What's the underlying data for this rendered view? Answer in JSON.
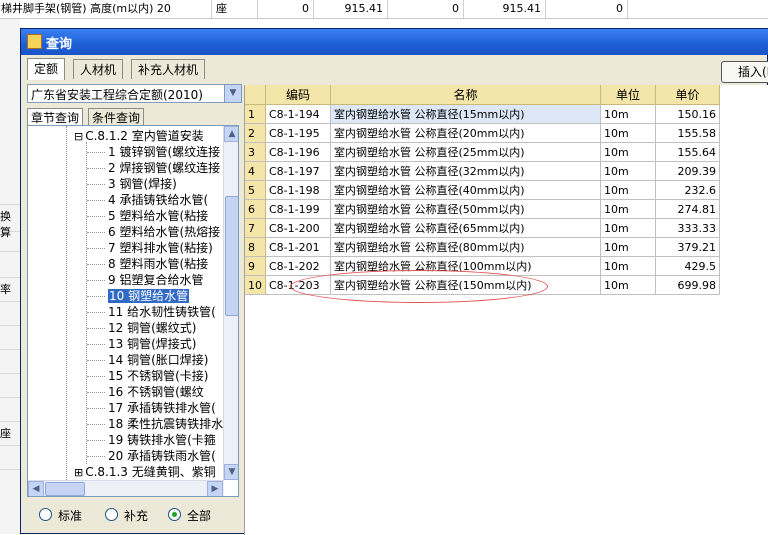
{
  "background": {
    "row_title": "梯井脚手架(钢管) 高度(m以内) 20",
    "row_unit": "座",
    "row_values": [
      "0",
      "915.41",
      "0",
      "915.41",
      "0"
    ],
    "left_labels": [
      "换算",
      "率",
      "座"
    ]
  },
  "dialog": {
    "title": "查询",
    "tabs": [
      "定额",
      "人材机",
      "补充人材机"
    ],
    "insert_button": "插入(I",
    "combo_value": "广东省安装工程综合定额(2010)",
    "subtabs": [
      "章节查询",
      "条件查询"
    ],
    "tree": [
      {
        "label": "C.8.1.2 室内管道安装",
        "expander": "⊟"
      },
      {
        "label": "1 镀锌钢管(螺纹连接"
      },
      {
        "label": "2 焊接钢管(螺纹连接"
      },
      {
        "label": "3 钢管(焊接)"
      },
      {
        "label": "4 承插铸铁给水管("
      },
      {
        "label": "5 塑料给水管(粘接"
      },
      {
        "label": "6 塑料给水管(热熔接"
      },
      {
        "label": "7 塑料排水管(粘接)"
      },
      {
        "label": "8 塑料雨水管(粘接"
      },
      {
        "label": "9 铝塑复合给水管"
      },
      {
        "label": "10 钢塑给水管"
      },
      {
        "label": "11 给水韧性铸铁管("
      },
      {
        "label": "12  铜管(螺纹式)"
      },
      {
        "label": "13 铜管(焊接式)"
      },
      {
        "label": "14 铜管(胀口焊接)"
      },
      {
        "label": "15 不锈钢管(卡接)"
      },
      {
        "label": "16 不锈钢管(螺纹"
      },
      {
        "label": "17 承插铸铁排水管("
      },
      {
        "label": "18 柔性抗震铸铁排水"
      },
      {
        "label": "19 铸铁排水管(卡箍"
      },
      {
        "label": "20 承插铸铁雨水管("
      },
      {
        "label": "C.8.1.3 无缝黄铜、紫铜",
        "expander": "⊞"
      }
    ],
    "radios": [
      {
        "label": "标准",
        "checked": false
      },
      {
        "label": "补充",
        "checked": false
      },
      {
        "label": "全部",
        "checked": true
      }
    ],
    "grid": {
      "headers": [
        "编码",
        "名称",
        "单位",
        "单价"
      ],
      "rows": [
        [
          "1",
          "C8-1-194",
          "室内钢塑给水管 公称直径(15mm以内)",
          "10m",
          "150.16"
        ],
        [
          "2",
          "C8-1-195",
          "室内钢塑给水管 公称直径(20mm以内)",
          "10m",
          "155.58"
        ],
        [
          "3",
          "C8-1-196",
          "室内钢塑给水管 公称直径(25mm以内)",
          "10m",
          "155.64"
        ],
        [
          "4",
          "C8-1-197",
          "室内钢塑给水管 公称直径(32mm以内)",
          "10m",
          "209.39"
        ],
        [
          "5",
          "C8-1-198",
          "室内钢塑给水管 公称直径(40mm以内)",
          "10m",
          "232.6"
        ],
        [
          "6",
          "C8-1-199",
          "室内钢塑给水管 公称直径(50mm以内)",
          "10m",
          "274.81"
        ],
        [
          "7",
          "C8-1-200",
          "室内钢塑给水管 公称直径(65mm以内)",
          "10m",
          "333.33"
        ],
        [
          "8",
          "C8-1-201",
          "室内钢塑给水管 公称直径(80mm以内)",
          "10m",
          "379.21"
        ],
        [
          "9",
          "C8-1-202",
          "室内钢塑给水管 公称直径(100mm以内)",
          "10m",
          "429.5"
        ],
        [
          "10",
          "C8-1-203",
          "室内钢塑给水管 公称直径(150mm以内)",
          "10m",
          "699.98"
        ]
      ]
    }
  }
}
